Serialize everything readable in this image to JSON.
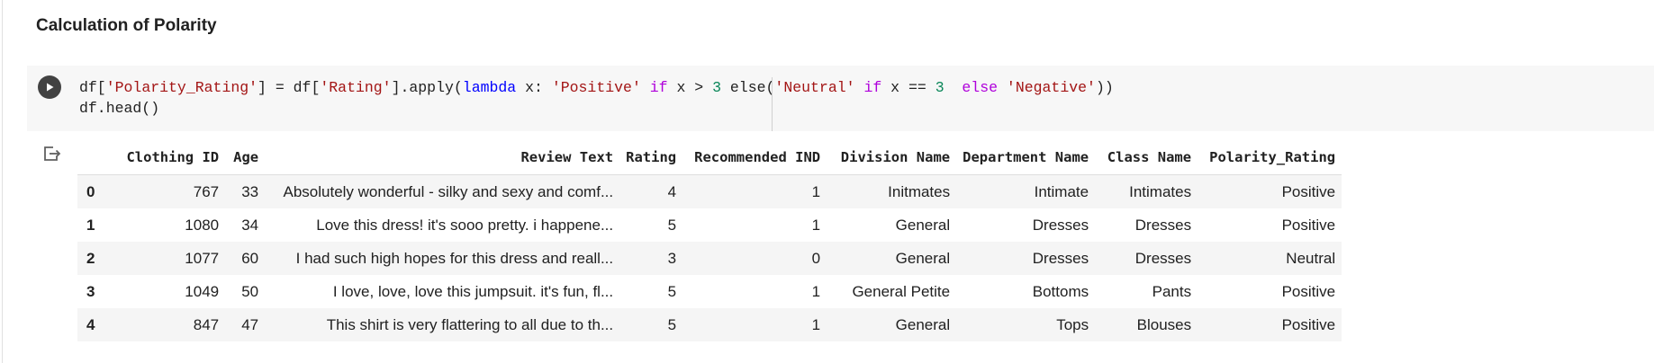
{
  "section": {
    "heading": "Calculation of Polarity"
  },
  "code_cell": {
    "line1": {
      "t1": "df[",
      "t2": "'Polarity_Rating'",
      "t3": "] = df[",
      "t4": "'Rating'",
      "t5": "].apply(",
      "t6": "lambda",
      "t7": " x: ",
      "t8": "'Positive'",
      "t9": " ",
      "t10": "if",
      "t11": " x > ",
      "t12": "3",
      "t13": " else(",
      "t14": "'Neutral'",
      "t15": " ",
      "t16": "if",
      "t17": " x == ",
      "t18": "3",
      "t19": "  ",
      "t20": "else",
      "t21": " ",
      "t22": "'Negative'",
      "t23": "))"
    },
    "line2": "df.head()",
    "run_icon": "play-icon"
  },
  "output": {
    "icon": "output-redirect-icon",
    "columns": [
      "Clothing ID",
      "Age",
      "Review Text",
      "Rating",
      "Recommended IND",
      "Division Name",
      "Department Name",
      "Class Name",
      "Polarity_Rating"
    ],
    "rows": [
      {
        "index": "0",
        "cells": [
          "767",
          "33",
          "Absolutely wonderful - silky and sexy and comf...",
          "4",
          "1",
          "Initmates",
          "Intimate",
          "Intimates",
          "Positive"
        ]
      },
      {
        "index": "1",
        "cells": [
          "1080",
          "34",
          "Love this dress! it's sooo pretty. i happene...",
          "5",
          "1",
          "General",
          "Dresses",
          "Dresses",
          "Positive"
        ]
      },
      {
        "index": "2",
        "cells": [
          "1077",
          "60",
          "I had such high hopes for this dress and reall...",
          "3",
          "0",
          "General",
          "Dresses",
          "Dresses",
          "Neutral"
        ]
      },
      {
        "index": "3",
        "cells": [
          "1049",
          "50",
          "I love, love, love this jumpsuit. it's fun, fl...",
          "5",
          "1",
          "General Petite",
          "Bottoms",
          "Pants",
          "Positive"
        ]
      },
      {
        "index": "4",
        "cells": [
          "847",
          "47",
          "This shirt is very flattering to all due to th...",
          "5",
          "1",
          "General",
          "Tops",
          "Blouses",
          "Positive"
        ]
      }
    ]
  },
  "colors": {
    "string": "#a31515",
    "keyword": "#af00db",
    "number": "#098658",
    "builtin": "#0000ff",
    "cell_background": "#f7f7f7"
  }
}
